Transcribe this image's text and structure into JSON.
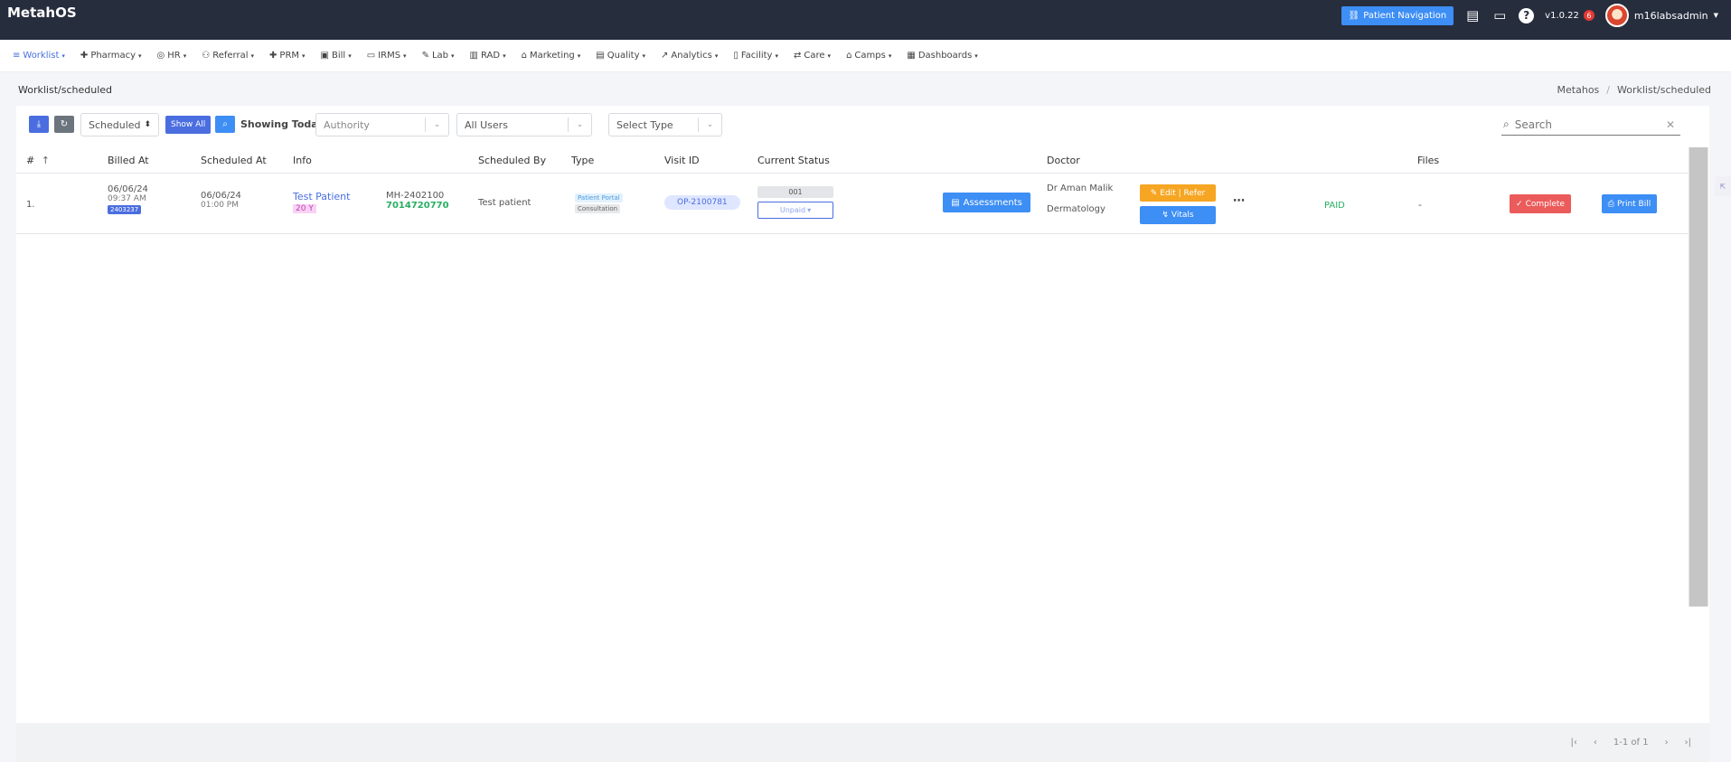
{
  "topbar": {
    "brand": "MetahOS",
    "patient_nav_label": "Patient Navigation",
    "version": "v1.0.22",
    "notif_count": "6",
    "username": "m16labsadmin"
  },
  "nav": {
    "items": [
      "Worklist",
      "Pharmacy",
      "HR",
      "Referral",
      "PRM",
      "Bill",
      "IRMS",
      "Lab",
      "RAD",
      "Marketing",
      "Quality",
      "Analytics",
      "Facility",
      "Care",
      "Camps",
      "Dashboards"
    ]
  },
  "breadcrumb": {
    "page": "Worklist/scheduled",
    "root": "Metahos",
    "separator": "/",
    "current": "Worklist/scheduled"
  },
  "toolbar": {
    "status_select": "Scheduled",
    "show_all": "Show All",
    "showing_today": "Showing Today",
    "authority_placeholder": "Authority",
    "users_value": "All Users",
    "type_placeholder": "Select Type",
    "search_placeholder": "Search"
  },
  "table": {
    "headers": {
      "num": "#",
      "billed_at": "Billed At",
      "scheduled_at": "Scheduled At",
      "info": "Info",
      "scheduled_by": "Scheduled By",
      "type": "Type",
      "visit_id": "Visit ID",
      "current_status": "Current Status",
      "doctor": "Doctor",
      "files": "Files"
    },
    "rows": [
      {
        "num": "1.",
        "billed_date": "06/06/24",
        "billed_time": "09:37 AM",
        "bill_no": "2403237",
        "sched_date": "06/06/24",
        "sched_time": "01:00 PM",
        "patient_name": "Test Patient",
        "age": "20 Y",
        "mh_id": "MH-2402100",
        "phone": "7014720770",
        "scheduled_by": "Test patient",
        "type_1": "Patient Portal",
        "type_2": "Consultation",
        "visit_id": "OP-2100781",
        "token": "001",
        "payment_status": "Unpaid",
        "assessments": "Assessments",
        "doctor": "Dr Aman Malik",
        "department": "Dermatology",
        "edit_refer": "Edit | Refer",
        "vitals": "Vitals",
        "paid": "PAID",
        "files": "-",
        "complete": "Complete",
        "print_bill": "Print Bill"
      }
    ]
  },
  "pager": {
    "range": "1-1 of 1"
  }
}
